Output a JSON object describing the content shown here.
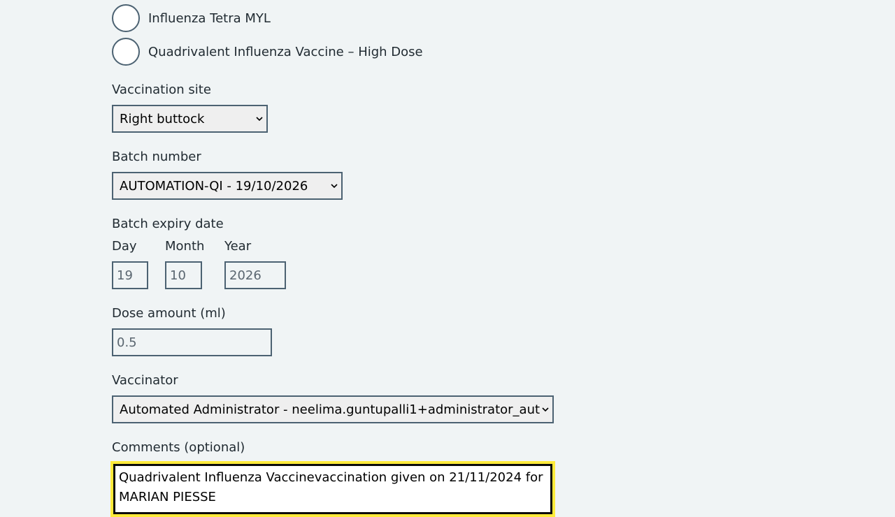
{
  "vaccine_options": [
    {
      "label": "Influenza Tetra MYL",
      "selected": false
    },
    {
      "label": "Quadrivalent Influenza Vaccine – High Dose",
      "selected": false
    }
  ],
  "vaccination_site": {
    "label": "Vaccination site",
    "value": "Right buttock"
  },
  "batch_number": {
    "label": "Batch number",
    "value": "AUTOMATION-QI - 19/10/2026"
  },
  "batch_expiry": {
    "label": "Batch expiry date",
    "day_label": "Day",
    "month_label": "Month",
    "year_label": "Year",
    "day": "19",
    "month": "10",
    "year": "2026"
  },
  "dose_amount": {
    "label": "Dose amount (ml)",
    "value": "0.5"
  },
  "vaccinator": {
    "label": "Vaccinator",
    "value": "Automated Administrator - neelima.guntupalli1+administrator_aut"
  },
  "comments": {
    "label": "Comments (optional)",
    "value": "Quadrivalent Influenza Vaccinevaccination given on 21/11/2024 for MARIAN PIESSE"
  },
  "colors": {
    "background": "#f0f4f5",
    "border": "#4c6272",
    "focus": "#ffeb3b",
    "text": "#212b32"
  }
}
